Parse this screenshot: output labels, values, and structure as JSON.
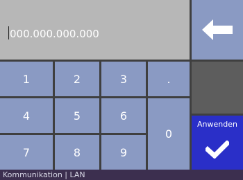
{
  "display": {
    "value": "000.000.000.000"
  },
  "keypad": {
    "keys": [
      "1",
      "2",
      "3",
      ".",
      "4",
      "5",
      "6",
      "0",
      "7",
      "8",
      "9"
    ]
  },
  "actions": {
    "backspace_icon": "left-arrow-icon",
    "apply_label": "Anwenden",
    "apply_icon": "checkmark-icon"
  },
  "status_bar": {
    "text": "Kommunikation | LAN"
  },
  "colors": {
    "key_bg": "#8a9ac3",
    "display_bg": "#b7b7b7",
    "apply_bg": "#2a2fc8",
    "gray_block": "#5d5d5d",
    "frame": "#3f3f3f"
  }
}
